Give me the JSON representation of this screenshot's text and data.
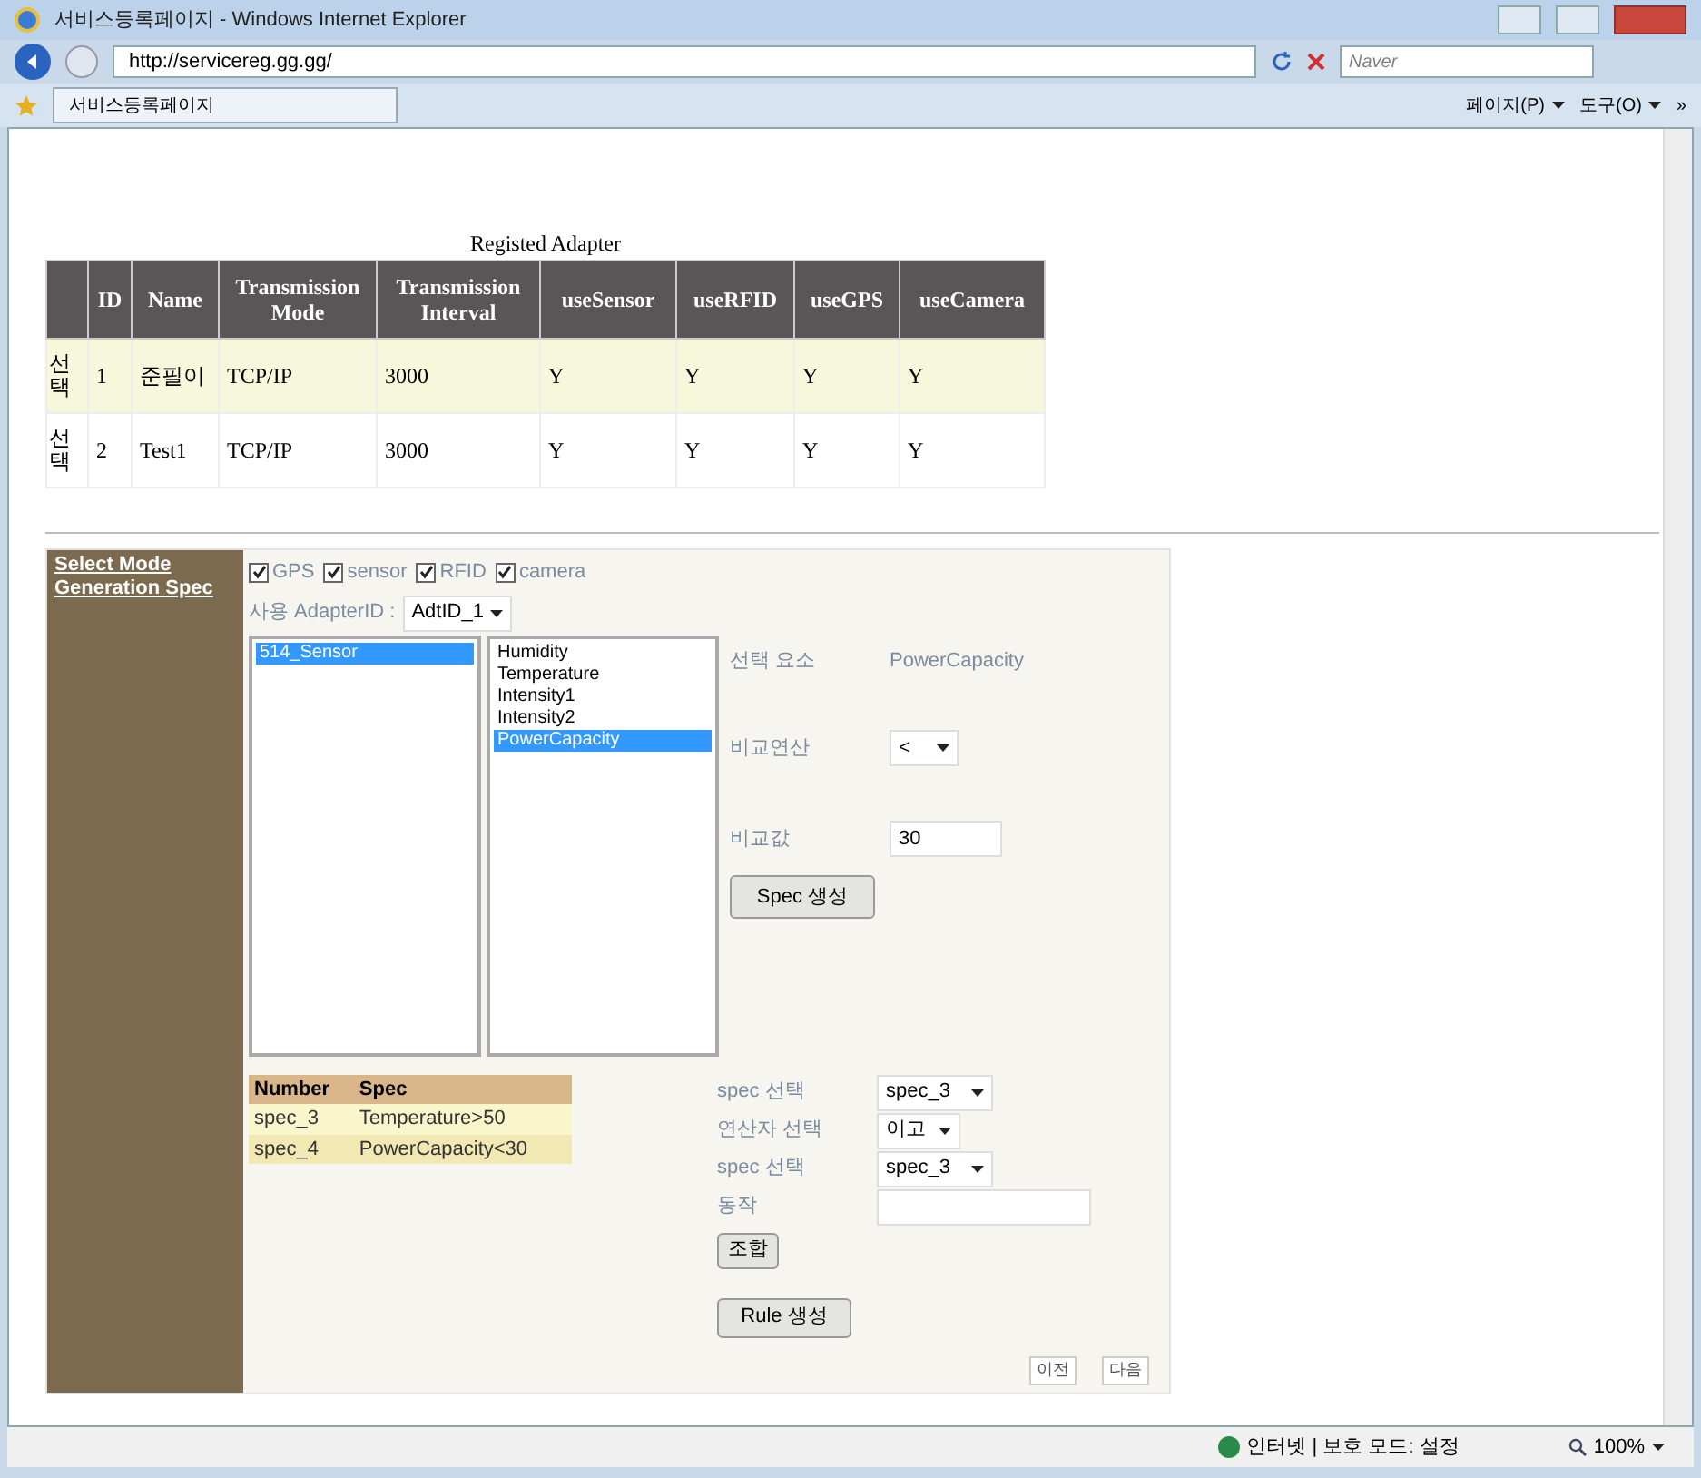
{
  "window": {
    "title": "서비스등록페이지 - Windows Internet Explorer"
  },
  "address_bar": {
    "url": "http://servicereg.gg.gg/",
    "search_placeholder": "Naver"
  },
  "tab": {
    "label": "서비스등록페이지"
  },
  "command_bar": {
    "page_menu": "페이지(P)",
    "tools_menu": "도구(O)",
    "more": "»"
  },
  "adapter_table": {
    "caption": "Registed Adapter",
    "columns": [
      "ID",
      "Name",
      "Transmission Mode",
      "Transmission Interval",
      "useSensor",
      "useRFID",
      "useGPS",
      "useCamera"
    ],
    "rows": [
      {
        "action": "선택",
        "selected": true,
        "cells": [
          "1",
          "준필이",
          "TCP/IP",
          "3000",
          "Y",
          "Y",
          "Y",
          "Y"
        ]
      },
      {
        "action": "선택",
        "selected": false,
        "cells": [
          "2",
          "Test1",
          "TCP/IP",
          "3000",
          "Y",
          "Y",
          "Y",
          "Y"
        ]
      }
    ]
  },
  "sidebar": {
    "links": [
      "Select Mode",
      "Generation Spec"
    ]
  },
  "filters": [
    {
      "label": "GPS",
      "checked": true
    },
    {
      "label": "sensor",
      "checked": true
    },
    {
      "label": "RFID",
      "checked": true
    },
    {
      "label": "camera",
      "checked": true
    }
  ],
  "adapter_select": {
    "label": "사용 AdapterID :",
    "value": "AdtID_1"
  },
  "sensor_list": [
    {
      "label": "514_Sensor",
      "selected": true
    }
  ],
  "element_list": [
    {
      "label": "Humidity",
      "selected": false
    },
    {
      "label": "Temperature",
      "selected": false
    },
    {
      "label": "Intensity1",
      "selected": false
    },
    {
      "label": "Intensity2",
      "selected": false
    },
    {
      "label": "PowerCapacity",
      "selected": true
    }
  ],
  "spec_form": {
    "element_label": "선택 요소",
    "element_value": "PowerCapacity",
    "operator_label": "비교연산",
    "operator_value": "<",
    "compare_label": "비교값",
    "compare_value": "30",
    "button": "Spec 생성"
  },
  "spec_table": {
    "columns": [
      "Number",
      "Spec"
    ],
    "rows": [
      [
        "spec_3",
        "Temperature>50"
      ],
      [
        "spec_4",
        "PowerCapacity<30"
      ]
    ]
  },
  "rule_form": {
    "spec1_label": "spec 선택",
    "spec1_value": "spec_3",
    "op_label": "연산자 선택",
    "op_value": "이고",
    "spec2_label": "spec 선택",
    "spec2_value": "spec_3",
    "action_label": "동작",
    "combine_button": "조합",
    "rule_button": "Rule 생성"
  },
  "pager": [
    "이전",
    "다음"
  ],
  "status_bar": {
    "zone": "인터넷 | 보호 모드: 설정",
    "zoom": "100%"
  }
}
